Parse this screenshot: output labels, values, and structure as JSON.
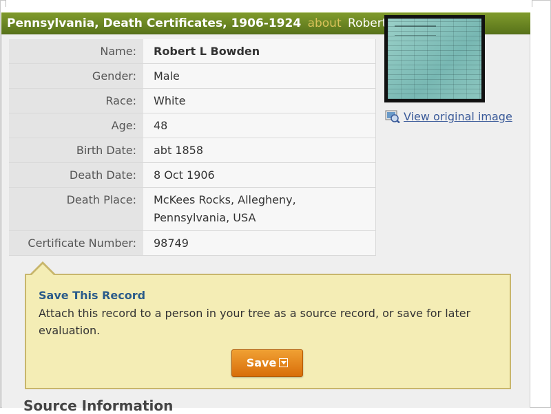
{
  "title_bar": {
    "collection": "Pennsylvania, Death Certificates, 1906-1924",
    "about": "about",
    "person": "Robert L Bowden"
  },
  "record": {
    "rows": [
      {
        "label": "Name:",
        "value": "Robert L Bowden"
      },
      {
        "label": "Gender:",
        "value": "Male"
      },
      {
        "label": "Race:",
        "value": "White"
      },
      {
        "label": "Age:",
        "value": "48"
      },
      {
        "label": "Birth Date:",
        "value": "abt 1858"
      },
      {
        "label": "Death Date:",
        "value": "8 Oct 1906"
      },
      {
        "label": "Death Place:",
        "value_line1": "McKees Rocks, Allegheny,",
        "value_line2": "Pennsylvania, USA"
      },
      {
        "label": "Certificate Number:",
        "value": "98749"
      }
    ]
  },
  "image_panel": {
    "link_text": "View original image",
    "icon": "view-image-icon"
  },
  "save_panel": {
    "title": "Save This Record",
    "text": "Attach this record to a person in your tree as a source record, or save for later evaluation.",
    "button_label": "Save",
    "dropdown_icon": "dropdown-arrow-icon"
  },
  "source_heading": "Source Information"
}
